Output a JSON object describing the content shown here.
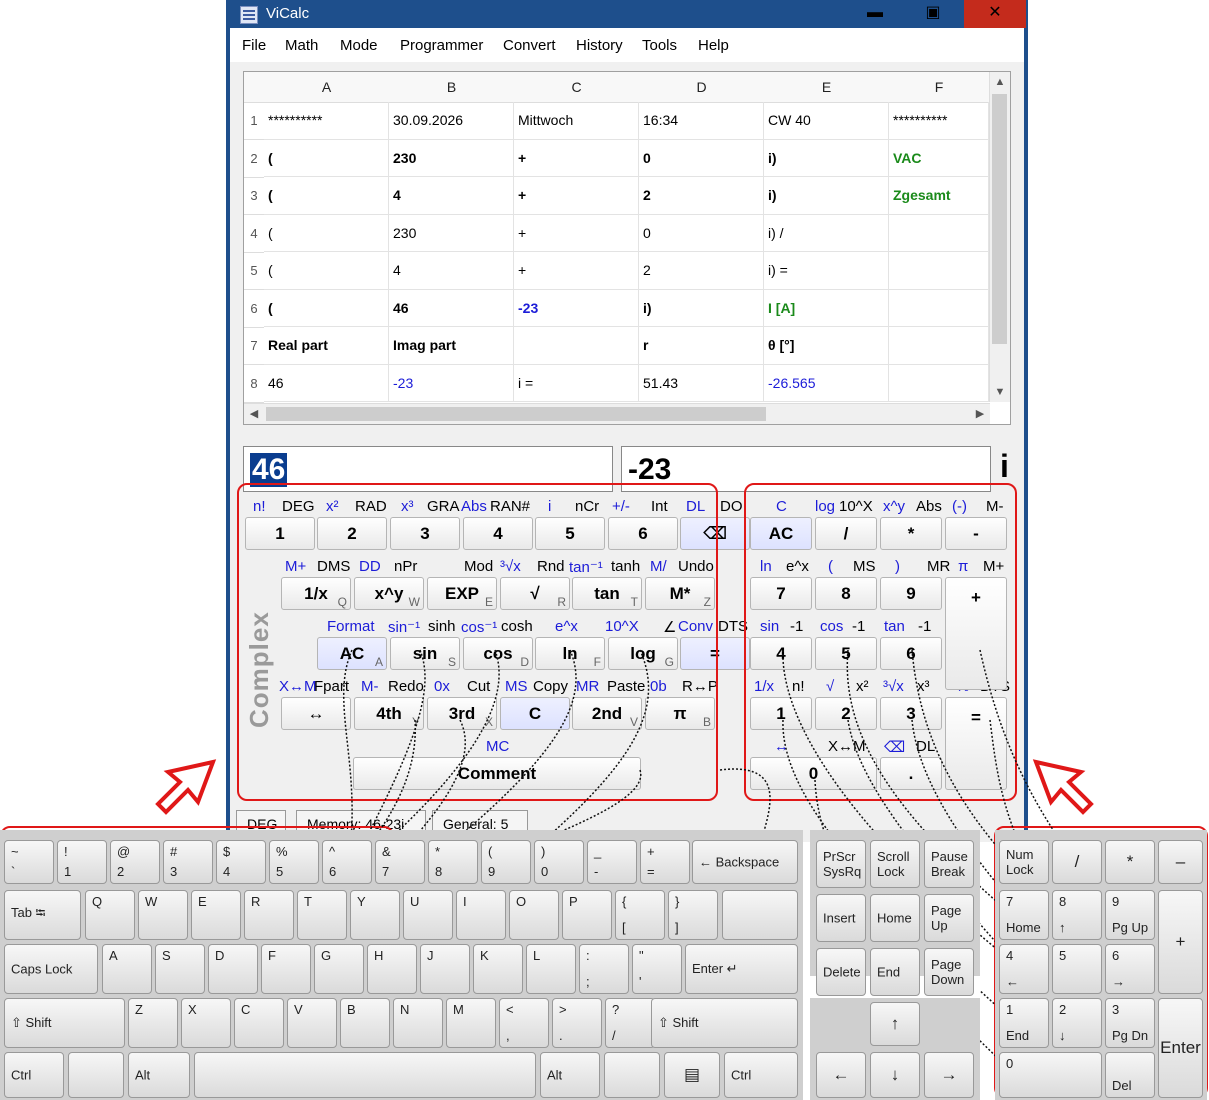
{
  "window": {
    "title": "ViCalc",
    "minimize": "▬",
    "maximize": "▣",
    "close": "✕"
  },
  "menu": [
    "File",
    "Math",
    "Mode",
    "Programmer",
    "Convert",
    "History",
    "Tools",
    "Help"
  ],
  "grid": {
    "columns": [
      "A",
      "B",
      "C",
      "D",
      "E",
      "F"
    ],
    "rows": [
      {
        "n": "1",
        "cells": [
          "**********",
          "30.09.2026",
          "Mittwoch",
          "16:34",
          "CW 40",
          "**********"
        ]
      },
      {
        "n": "2",
        "cells": [
          "(",
          "230",
          "+",
          "0",
          "i)",
          "VAC"
        ]
      },
      {
        "n": "3",
        "cells": [
          "(",
          "4",
          "+",
          "2",
          "i)",
          "Zgesamt"
        ]
      },
      {
        "n": "4",
        "cells": [
          "(",
          "230",
          "+",
          "0",
          "i) /",
          ""
        ]
      },
      {
        "n": "5",
        "cells": [
          "(",
          "4",
          "+",
          "2",
          "i) =",
          ""
        ]
      },
      {
        "n": "6",
        "cells": [
          "(",
          "46",
          "-23",
          "i)",
          "I [A]",
          ""
        ]
      },
      {
        "n": "7",
        "cells": [
          "Real part",
          "Imag part",
          "",
          "r",
          "θ [°]",
          ""
        ]
      },
      {
        "n": "8",
        "cells": [
          "46",
          "-23",
          "i =",
          "51.43",
          "-26.565",
          ""
        ]
      }
    ]
  },
  "display": {
    "real": "46",
    "imag": "-23",
    "suffix": "i"
  },
  "side_label": "Complex",
  "labels": {
    "row1": [
      "n!",
      "DEG",
      "x²",
      "RAD",
      "x³",
      "GRA",
      "Abs",
      "RAN#",
      "i",
      "nCr",
      "+/-",
      "Int",
      "DL",
      "DO"
    ],
    "row2": [
      "M+",
      "DMS",
      "DD",
      "nPr",
      "Mod",
      "³√x",
      "Rnd",
      "tan⁻¹",
      "tanh",
      "M/",
      "Undo"
    ],
    "row3": [
      "Format",
      "sin⁻¹",
      "sinh",
      "cos⁻¹",
      "cosh",
      "e^x",
      "10^X",
      "∠",
      "Conv",
      "DTS"
    ],
    "row4": [
      "X↔M",
      "Fpart",
      "M-",
      "Redo",
      "0x",
      "Cut",
      "MS",
      "Copy",
      "MR",
      "Paste",
      "0b",
      "R↔P"
    ],
    "row5": [
      "MC"
    ],
    "right1": [
      "C",
      "log",
      "10^X",
      "x^y",
      "Abs",
      "(-)",
      "M-"
    ],
    "right2": [
      "ln",
      "e^x",
      "(",
      "MS",
      ")",
      "MR",
      "π",
      "M+"
    ],
    "right3": [
      "sin",
      "-1",
      "cos",
      "-1",
      "tan",
      "-1"
    ],
    "right4": [
      "1/x",
      "n!",
      "√",
      "x²",
      "³√x",
      "x³",
      "%",
      "DTS"
    ],
    "right5": [
      "↔",
      "X↔M",
      "⌫",
      "DL"
    ]
  },
  "keys": {
    "row1": [
      "1",
      "2",
      "3",
      "4",
      "5",
      "6",
      "⌫"
    ],
    "row2": [
      {
        "l": "1/x",
        "s": "Q"
      },
      {
        "l": "x^y",
        "s": "W"
      },
      {
        "l": "EXP",
        "s": "E"
      },
      {
        "l": "√",
        "s": "R"
      },
      {
        "l": "tan",
        "s": "T"
      },
      {
        "l": "M*",
        "s": "Z"
      }
    ],
    "row3": [
      {
        "l": "AC",
        "s": "A"
      },
      {
        "l": "sin",
        "s": "S"
      },
      {
        "l": "cos",
        "s": "D"
      },
      {
        "l": "ln",
        "s": "F"
      },
      {
        "l": "log",
        "s": "G"
      },
      {
        "l": "=",
        "s": ""
      }
    ],
    "row4": [
      {
        "l": "↔",
        "s": ""
      },
      {
        "l": "4th",
        "s": "Y"
      },
      {
        "l": "3rd",
        "s": "X"
      },
      {
        "l": "C",
        "s": ""
      },
      {
        "l": "2nd",
        "s": "V"
      },
      {
        "l": "π",
        "s": "B"
      }
    ],
    "comment": "Comment",
    "right": [
      "AC",
      "/",
      "*",
      "-",
      "7",
      "8",
      "9",
      "+",
      "4",
      "5",
      "6",
      "1",
      "2",
      "3",
      "=",
      "0",
      "."
    ]
  },
  "status": {
    "mode": "DEG",
    "memory": "Memory: 46-23i",
    "format": "General: 5"
  },
  "keyboard": {
    "row1": [
      [
        "~",
        "`"
      ],
      [
        "!",
        "1"
      ],
      [
        "@",
        "2"
      ],
      [
        "#",
        "3"
      ],
      [
        "$",
        "4"
      ],
      [
        "%",
        "5"
      ],
      [
        "^",
        "6"
      ],
      [
        "&",
        "7"
      ],
      [
        "*",
        "8"
      ],
      [
        "(",
        "9"
      ],
      [
        ")",
        "0"
      ],
      [
        "_",
        "-"
      ],
      [
        "+",
        "="
      ]
    ],
    "backspace": "← Backspace",
    "tab": "Tab ⭾",
    "row2": [
      "Q",
      "W",
      "E",
      "R",
      "T",
      "Y",
      "U",
      "I",
      "O",
      "P"
    ],
    "row2b": [
      [
        "{",
        "["
      ],
      [
        "}",
        "]"
      ]
    ],
    "capslock": "Caps Lock",
    "row3": [
      "A",
      "S",
      "D",
      "F",
      "G",
      "H",
      "J",
      "K",
      "L"
    ],
    "row3b": [
      [
        ":",
        ";"
      ],
      [
        "\"",
        "'"
      ]
    ],
    "enter": "Enter ↵",
    "shift": "⇧ Shift",
    "row4": [
      "Z",
      "X",
      "C",
      "V",
      "B",
      "N",
      "M"
    ],
    "row4b": [
      [
        "<",
        ","
      ],
      [
        ">",
        "."
      ],
      [
        "?",
        "/"
      ],
      [
        "|",
        "\\"
      ]
    ],
    "rshift": "⇧ Shift",
    "ctrl": "Ctrl",
    "alt": "Alt",
    "altgr": "Alt",
    "menu_key": "▤",
    "rctrl": "Ctrl",
    "nav": [
      "PrScr SysRq",
      "Scroll Lock",
      "Pause Break",
      "Insert",
      "Home",
      "Page Up",
      "Delete",
      "End",
      "Page Down"
    ],
    "arrows": [
      "↑",
      "←",
      "↓",
      "→"
    ],
    "numpad": {
      "numlock": "Num Lock",
      "div": "/",
      "mul": "*",
      "minus": "–",
      "n7": [
        "7",
        "Home"
      ],
      "n8": [
        "8",
        "↑"
      ],
      "n9": [
        "9",
        "Pg Up"
      ],
      "plus": "+",
      "n4": [
        "4",
        "←"
      ],
      "n5": [
        "5",
        ""
      ],
      "n6": [
        "6",
        "→"
      ],
      "n1": [
        "1",
        "End"
      ],
      "n2": [
        "2",
        "↓"
      ],
      "n3": [
        "3",
        "Pg Dn"
      ],
      "enter": "Enter",
      "n0": [
        "0",
        ""
      ],
      "del": [
        "",
        "Del"
      ]
    }
  }
}
